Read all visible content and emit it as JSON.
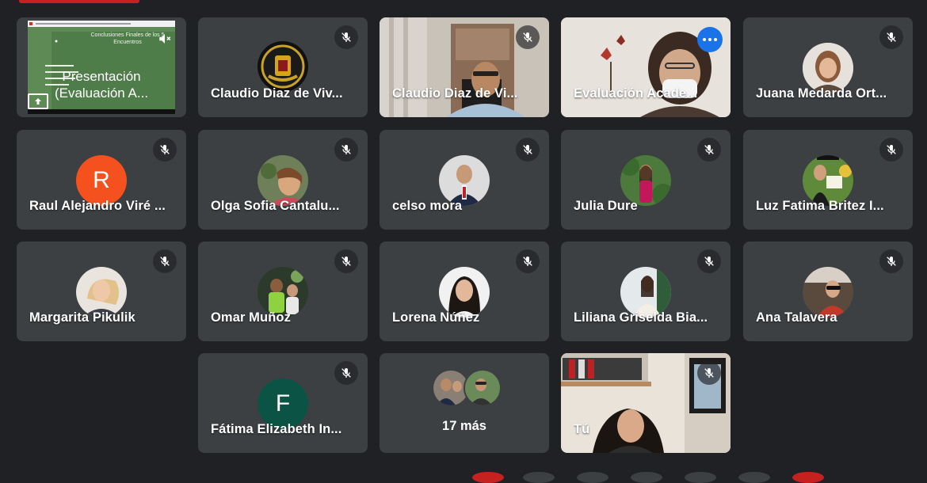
{
  "colors": {
    "background": "#202124",
    "tile": "#3c4043",
    "active_border": "#8ab4f8",
    "menu_button": "#1a73e8",
    "avatar_red": "#f4511e",
    "avatar_teal": "#0b5345"
  },
  "presentation": {
    "title_line1": "Presentación",
    "title_line2": "(Evaluación A...",
    "slide_heading": "Conclusiones Finales de los 5 Encuentros",
    "icon": "present-screen-icon"
  },
  "participants": [
    {
      "name": "Claudio Diaz de Viv...",
      "muted": true,
      "avatar": "logo-emblem"
    },
    {
      "name": "Claudio Diaz de Vi...",
      "muted": true,
      "avatar": "video"
    },
    {
      "name": "Evaluación Acade...",
      "muted": false,
      "avatar": "video",
      "active": true
    },
    {
      "name": "Juana Medarda Ort...",
      "muted": true,
      "avatar": "photo"
    },
    {
      "name": "Raul Alejandro Viré ...",
      "muted": true,
      "avatar_letter": "R"
    },
    {
      "name": "Olga Sofia Cantalu...",
      "muted": true,
      "avatar": "photo"
    },
    {
      "name": "celso mora",
      "muted": true,
      "avatar": "photo"
    },
    {
      "name": "Julia Dure",
      "muted": true,
      "avatar": "photo"
    },
    {
      "name": "Luz Fatima Britez I...",
      "muted": true,
      "avatar": "photo"
    },
    {
      "name": "Margarita Pikulik",
      "muted": true,
      "avatar": "photo"
    },
    {
      "name": "Omar Muñoz",
      "muted": true,
      "avatar": "photo"
    },
    {
      "name": "Lorena Núñez",
      "muted": true,
      "avatar": "photo"
    },
    {
      "name": "Liliana Griselda Bia...",
      "muted": true,
      "avatar": "photo"
    },
    {
      "name": "Ana Talavera",
      "muted": true,
      "avatar": "photo"
    },
    {
      "name": "Fátima Elizabeth In...",
      "muted": true,
      "avatar_letter": "F"
    }
  ],
  "more": {
    "label": "17 más"
  },
  "self": {
    "name": "Tú",
    "muted": true
  }
}
